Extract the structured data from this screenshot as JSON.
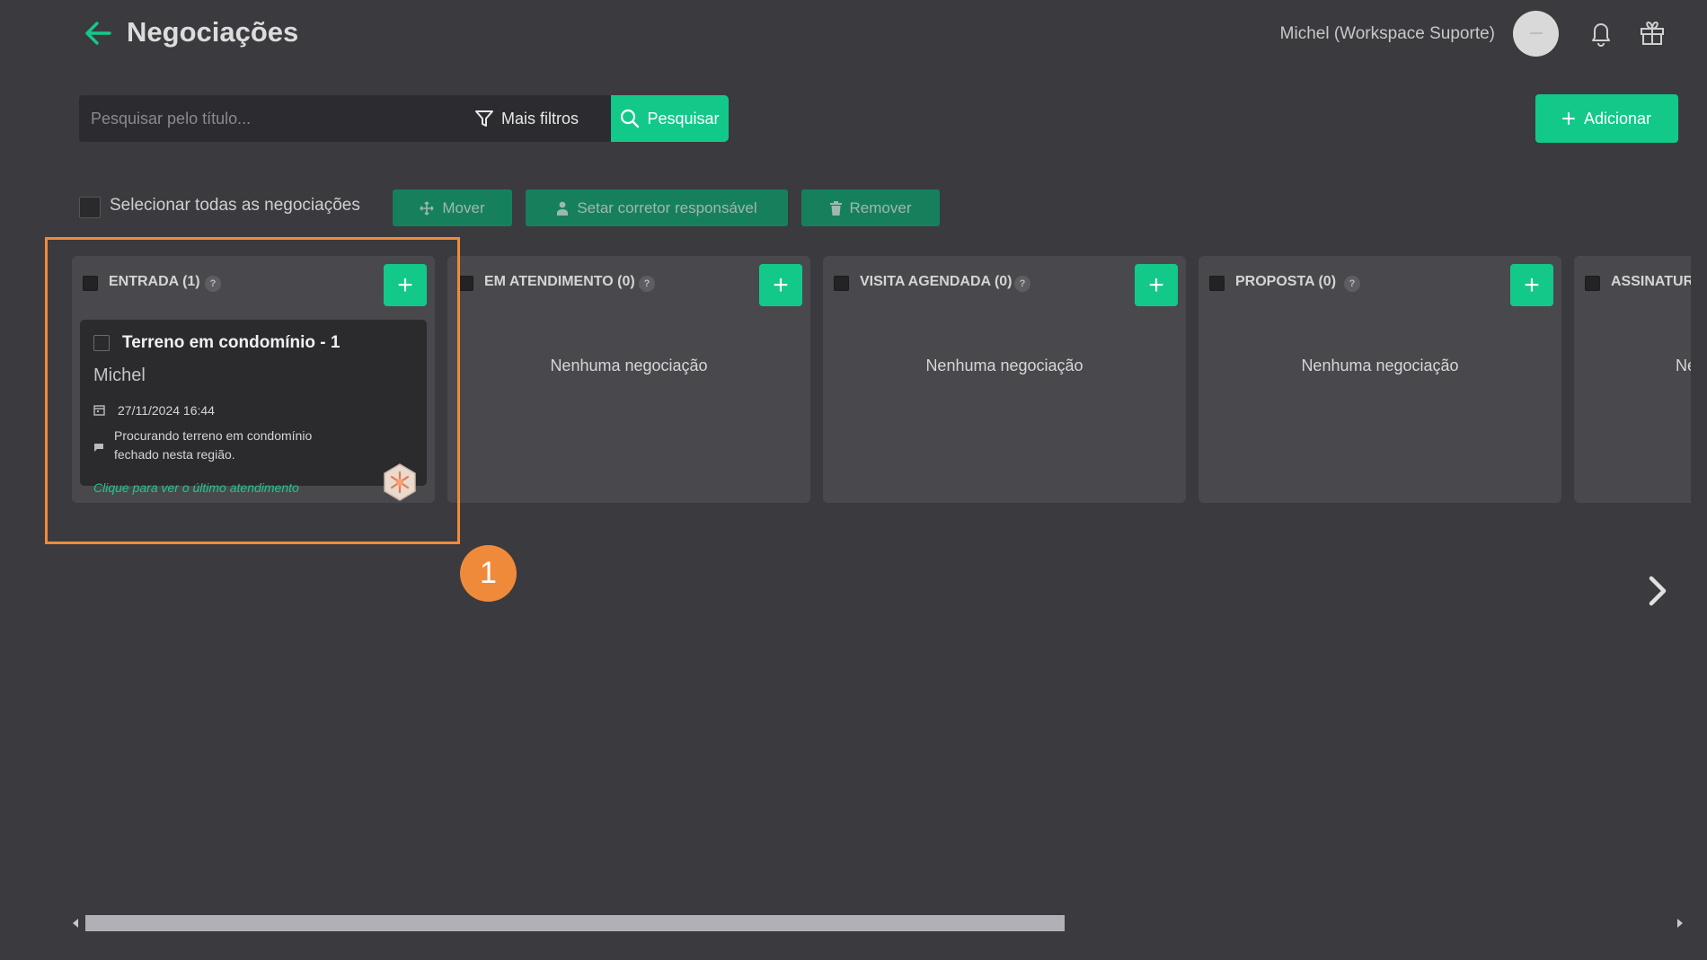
{
  "header": {
    "title": "Negociações",
    "user_name": "Michel (Workspace Suporte)"
  },
  "search": {
    "placeholder": "Pesquisar pelo título...",
    "filters_label": "Mais filtros",
    "search_label": "Pesquisar"
  },
  "add_label": "Adicionar",
  "toolbar": {
    "select_all_label": "Selecionar todas as negociações",
    "move_label": "Mover",
    "assign_label": "Setar corretor responsável",
    "remove_label": "Remover"
  },
  "columns": [
    {
      "name": "ENTRADA",
      "count": "(1)",
      "empty_text": ""
    },
    {
      "name": "EM ATENDIMENTO",
      "count": "(0)",
      "empty_text": "Nenhuma negociação"
    },
    {
      "name": "VISITA AGENDADA",
      "count": "(0)",
      "empty_text": "Nenhuma negociação"
    },
    {
      "name": "PROPOSTA",
      "count": "(0)",
      "empty_text": "Nenhuma negociação"
    },
    {
      "name": "ASSINATURA",
      "count": "",
      "empty_text": "Nenhuma negociação"
    }
  ],
  "deal_card": {
    "title": "Terreno em condomínio - 1",
    "owner": "Michel",
    "date": "27/11/2024 16:44",
    "description_line1": "Procurando terreno em condomínio",
    "description_line2": "fechado nesta região.",
    "last_service_link": "Clique para ver o último atendimento"
  },
  "step_marker": "1",
  "help_glyph": "?",
  "colors": {
    "accent": "#12c98a",
    "highlight": "#f08a3b",
    "background": "#3b3b3f"
  }
}
